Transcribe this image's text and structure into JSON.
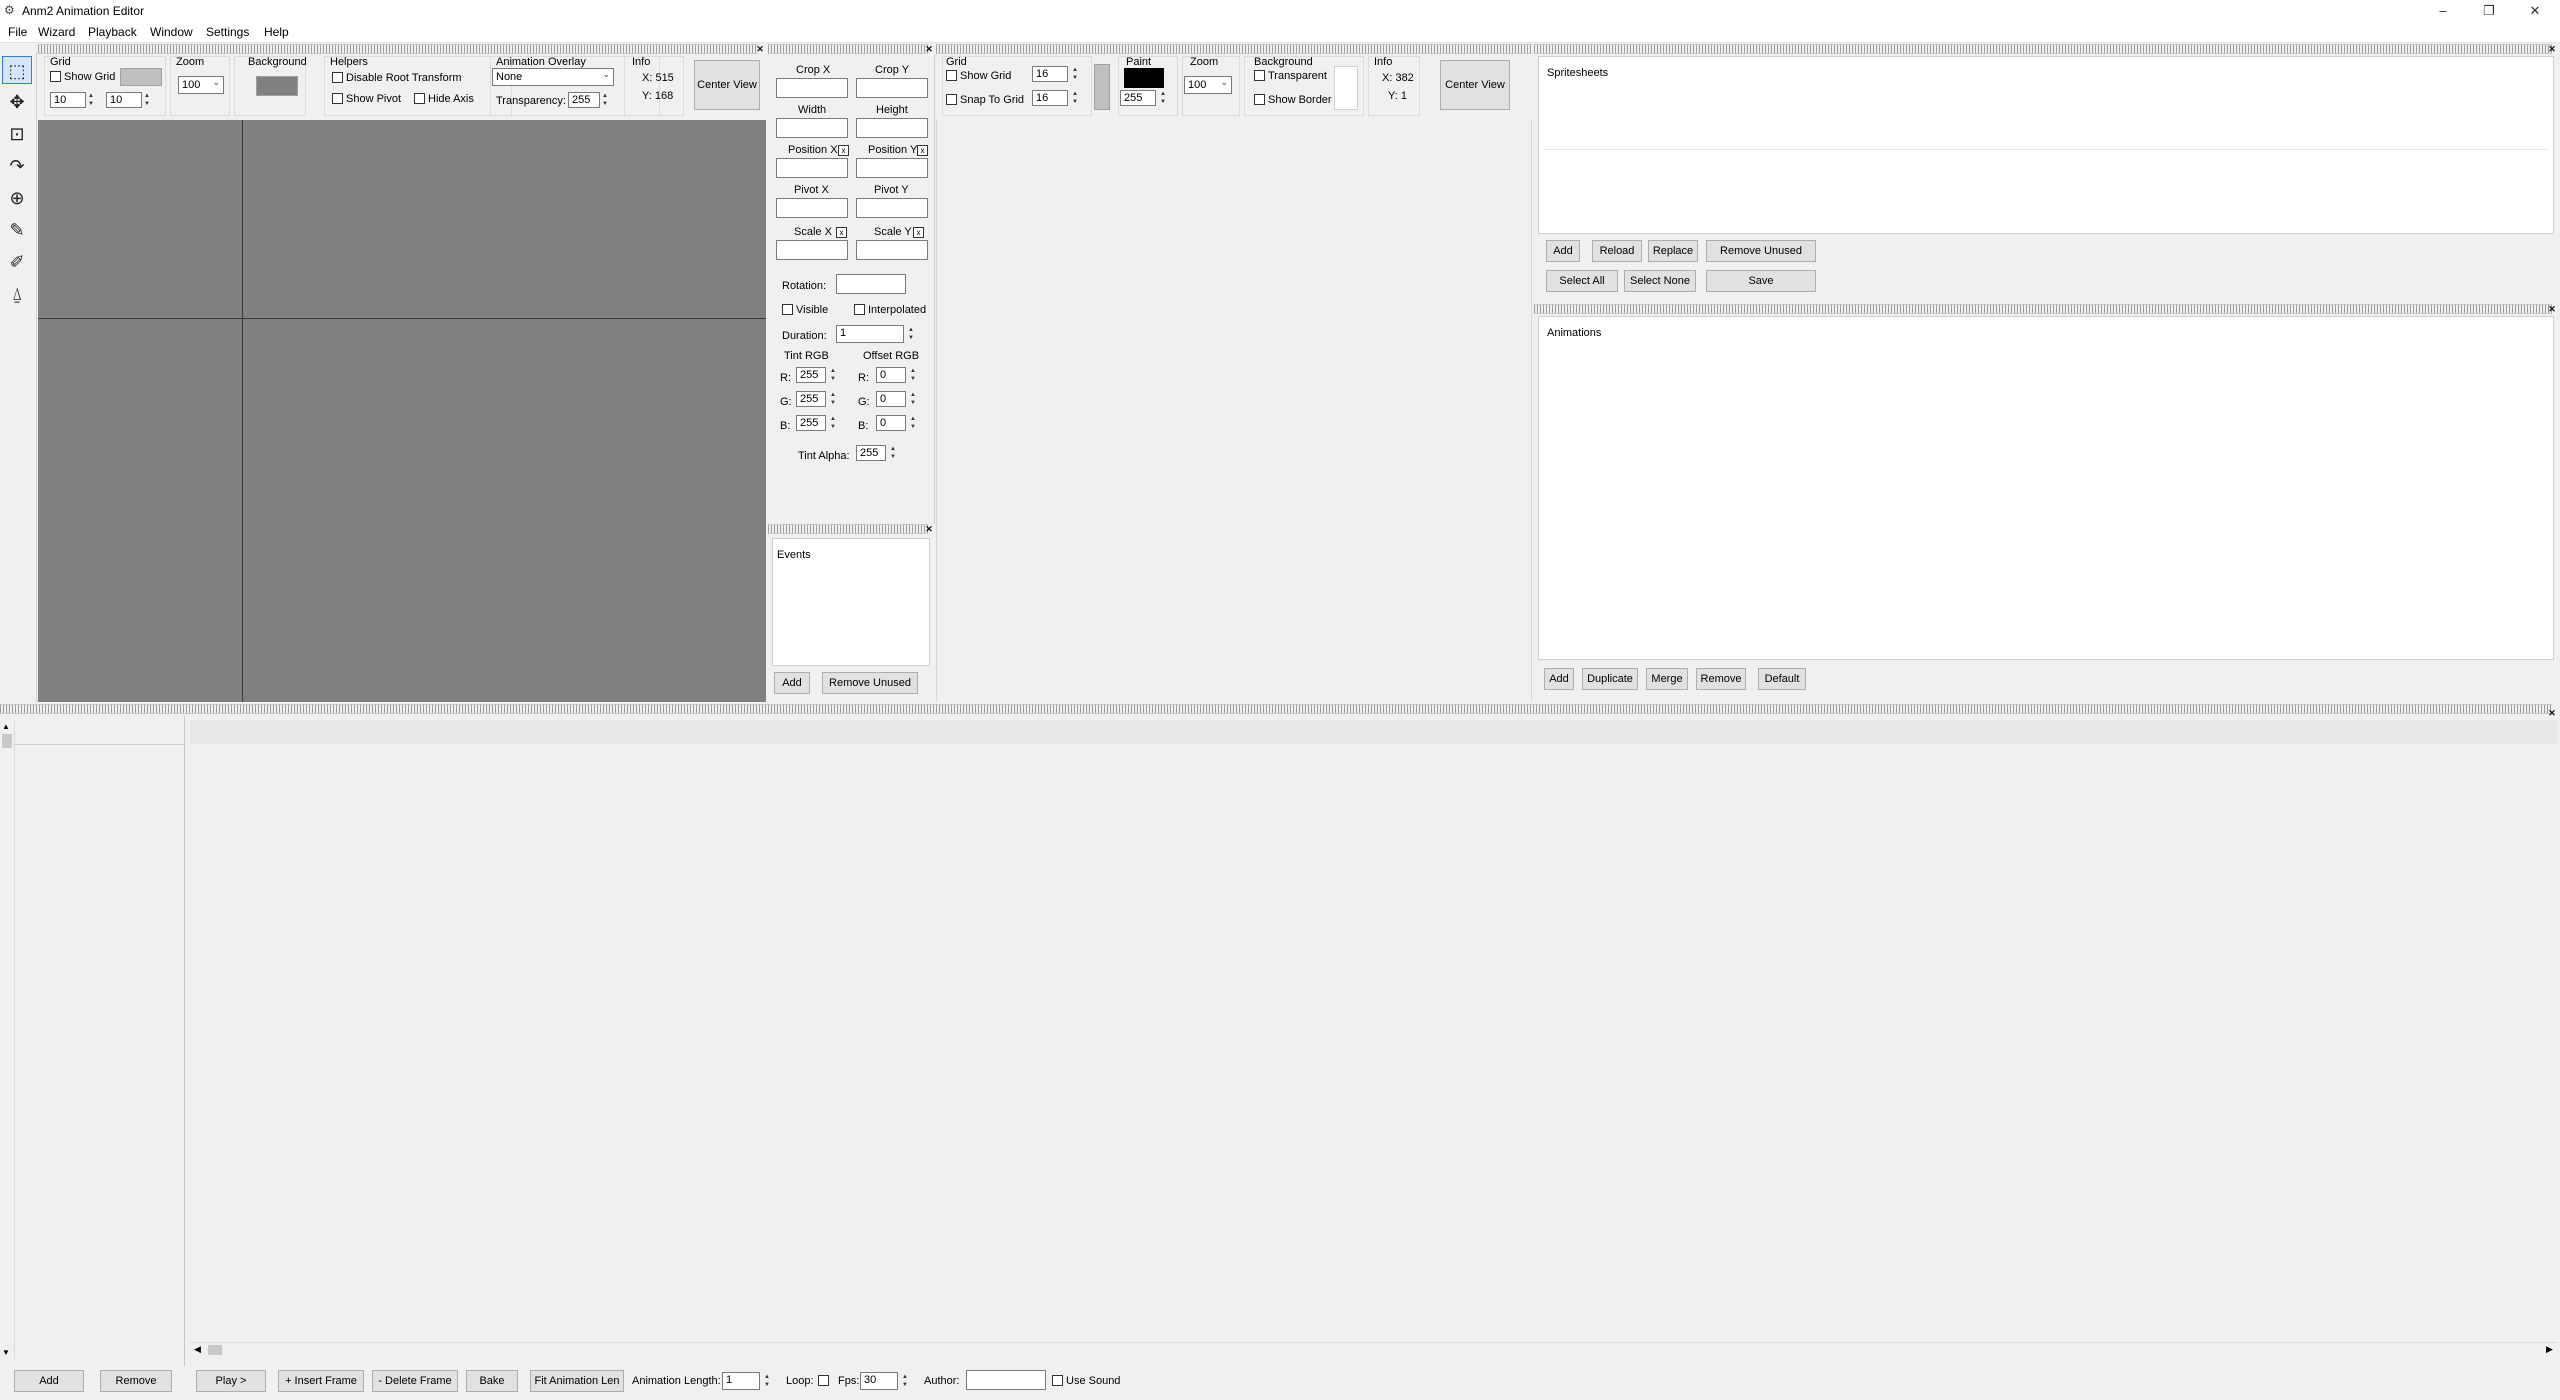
{
  "window": {
    "title": "Anm2 Animation Editor",
    "minimize": "–",
    "restore": "❐",
    "close": "✕"
  },
  "menu": [
    "File",
    "Wizard",
    "Playback",
    "Window",
    "Settings",
    "Help"
  ],
  "colors": {
    "canvas_bg": "#808080",
    "paint": "#000000",
    "swatch_grid": "#c0c0c0"
  },
  "animation_view": {
    "grid_label": "Grid",
    "show_grid": "Show Grid",
    "grid_x": "10",
    "grid_y": "10",
    "zoom_label": "Zoom",
    "zoom_value": "100",
    "background_label": "Background",
    "helpers_label": "Helpers",
    "disable_root": "Disable Root Transform",
    "show_pivot": "Show Pivot",
    "hide_axis": "Hide Axis",
    "overlay_label": "Animation Overlay",
    "overlay_value": "None",
    "transparency_label": "Transparency:",
    "transparency_value": "255",
    "info_label": "Info",
    "info_x": "X: 515",
    "info_y": "Y: 168",
    "center_view": "Center View"
  },
  "frame_props": {
    "crop_x": "Crop X",
    "crop_y": "Crop Y",
    "width": "Width",
    "height": "Height",
    "position_x": "Position X",
    "position_y": "Position Y",
    "pivot_x": "Pivot X",
    "pivot_y": "Pivot Y",
    "scale_x": "Scale X",
    "scale_y": "Scale Y",
    "x_mark": "x",
    "rotation": "Rotation:",
    "visible": "Visible",
    "interpolated": "Interpolated",
    "duration": "Duration:",
    "duration_value": "1",
    "tint_rgb": "Tint RGB",
    "offset_rgb": "Offset RGB",
    "r": "R:",
    "g": "G:",
    "b": "B:",
    "tint_r": "255",
    "tint_g": "255",
    "tint_b": "255",
    "off_r": "0",
    "off_g": "0",
    "off_b": "0",
    "tint_alpha": "Tint Alpha:",
    "tint_alpha_value": "255"
  },
  "events": {
    "title": "Events",
    "add": "Add",
    "remove_unused": "Remove Unused"
  },
  "spritesheet_editor": {
    "grid_label": "Grid",
    "show_grid": "Show Grid",
    "snap_to_grid": "Snap To Grid",
    "grid_w": "16",
    "grid_h": "16",
    "paint_label": "Paint",
    "paint_alpha": "255",
    "zoom_label": "Zoom",
    "zoom_value": "100",
    "background_label": "Background",
    "transparent": "Transparent",
    "show_border": "Show Border",
    "info_label": "Info",
    "info_x": "X: 382",
    "info_y": "Y: 1",
    "center_view": "Center View"
  },
  "spritesheets": {
    "title": "Spritesheets",
    "add": "Add",
    "reload": "Reload",
    "replace": "Replace",
    "remove_unused": "Remove Unused",
    "select_all": "Select All",
    "select_none": "Select None",
    "save": "Save"
  },
  "animations": {
    "title": "Animations",
    "add": "Add",
    "duplicate": "Duplicate",
    "merge": "Merge",
    "remove": "Remove",
    "default": "Default"
  },
  "timeline": {
    "add": "Add",
    "remove": "Remove",
    "play": "Play >",
    "insert_frame": "+ Insert Frame",
    "delete_frame": "- Delete Frame",
    "bake": "Bake",
    "fit_len": "Fit Animation Len",
    "anim_length": "Animation Length:",
    "anim_length_value": "1",
    "loop": "Loop:",
    "fps": "Fps:",
    "fps_value": "30",
    "author": "Author:",
    "author_value": "",
    "use_sound": "Use Sound"
  }
}
